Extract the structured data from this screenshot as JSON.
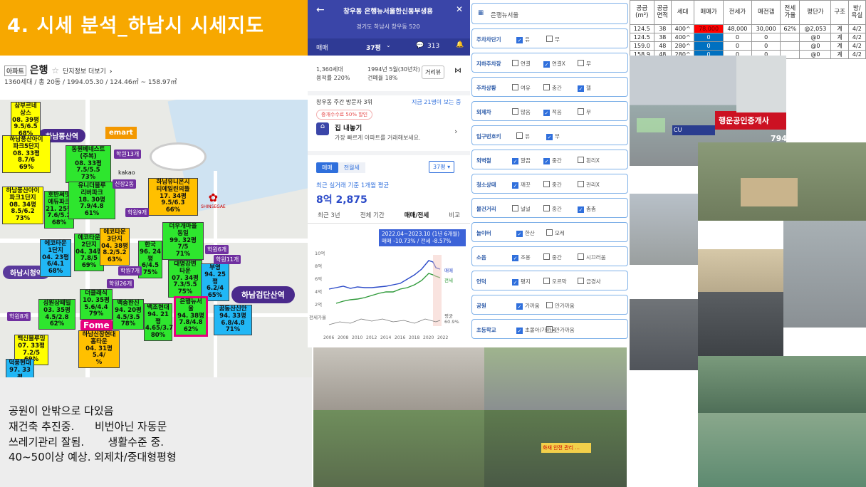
{
  "slide_title": "4. 시세 분석_하남시 시세지도",
  "map_header": {
    "tag": "아파트",
    "name": "은행",
    "link": "단지정보 더보기",
    "detail": "1360세대 / 총 20동 / 1994.05.30 / 124.46㎡ ~ 158.97㎡"
  },
  "stations": [
    {
      "name": "하남풍산역"
    },
    {
      "name": "하남검단산역"
    },
    {
      "name": "하남시청역"
    }
  ],
  "map_markers": {
    "emart": "emart",
    "kakao": "kakao",
    "shinsegae": "SHINSEGAE",
    "fome": "Fome"
  },
  "apt_labels": [
    {
      "l1": "삼부르네상스",
      "l2": "08. 39평",
      "l3": "9.5/6.5",
      "l4": "68%",
      "cls": "y"
    },
    {
      "l1": "하남풍산아이",
      "l2": "파크5단지",
      "l3": "08. 33평",
      "l4": "8.7/6",
      "l5": "69%",
      "cls": "y"
    },
    {
      "l1": "동원베네스트",
      "l2": "(주복)",
      "l3": "08. 33평",
      "l4": "7.5/5.5",
      "l5": "73%",
      "cls": "g"
    },
    {
      "l1": "하남풍산아이",
      "l2": "파크1단지",
      "l3": "08. 34평",
      "l4": "8.5/6.2",
      "l5": "73%",
      "cls": "y"
    },
    {
      "l1": "호반써밋",
      "l2": "에듀파크",
      "l3": "21. 25평",
      "l4": "7.6/5.2",
      "l5": "68%",
      "cls": "g"
    },
    {
      "l1": "유니더블루",
      "l2": "리버파크",
      "l3": "18. 30평",
      "l4": "7.9/4.8",
      "l5": "61%",
      "cls": "g"
    },
    {
      "l1": "하남유니온시",
      "l2": "티에일린의뜰",
      "l3": "17. 34평",
      "l4": "9.5/6.3",
      "l5": "66%",
      "cls": "o"
    },
    {
      "l1": "에코타운",
      "l2": "1단지",
      "l3": "04. 23평",
      "l4": "6/4.1",
      "l5": "68%",
      "cls": "c"
    },
    {
      "l1": "에코타운",
      "l2": "2단지",
      "l3": "04. 34평",
      "l4": "7.8/5",
      "l5": "69%",
      "cls": "g"
    },
    {
      "l1": "에코타운",
      "l2": "3단지",
      "l3": "04. 38평",
      "l4": "8.2/5.2",
      "l5": "63%",
      "cls": "o"
    },
    {
      "l1": "한국",
      "l2": "96. 24평",
      "l3": "6/4.5",
      "l4": "75%",
      "cls": "g"
    },
    {
      "l1": "더우개마을",
      "l2": "동일",
      "l3": "99. 32평",
      "l4": "7/5",
      "l5": "71%",
      "cls": "g"
    },
    {
      "l1": "대명강변",
      "l2": "타운",
      "l3": "07. 34평",
      "l4": "7.3/5.5",
      "l5": "75%",
      "cls": "g"
    },
    {
      "l1": "부영",
      "l2": "94. 25평",
      "l3": "6.2/4",
      "l4": "65%",
      "cls": "c"
    },
    {
      "l1": "성원상떼빌",
      "l2": "03. 35평",
      "l3": "4.5/2.8",
      "l4": "62%",
      "cls": "g"
    },
    {
      "l1": "더클래식",
      "l2": "10. 35평",
      "l3": "5.6/4.4",
      "l4": "79%",
      "cls": "g"
    },
    {
      "l1": "백송한신",
      "l2": "94. 20평",
      "l3": "4.5/3.5",
      "l4": "78%",
      "cls": "g"
    },
    {
      "l1": "백조현대",
      "l2": "94. 21평",
      "l3": "4.65/3.7",
      "l4": "80%",
      "cls": "g"
    },
    {
      "l1": "은행뉴서",
      "l2": "울",
      "l3": "94. 38평",
      "l4": "7.8/4.8",
      "l5": "62%",
      "cls": "g"
    },
    {
      "l1": "꿈동산신안",
      "l2": "94. 33평",
      "l3": "6.8/4.8",
      "l4": "71%",
      "cls": "c"
    },
    {
      "l1": "하남신장현대",
      "l2": "홈타운",
      "l3": "04. 31평",
      "l4": "5.4/",
      "l5": "%",
      "cls": "o"
    },
    {
      "l1": "백신블루밍",
      "l2": "07. 33평",
      "l3": "7.2/5",
      "l4": "69%",
      "cls": "y"
    },
    {
      "l1": "덕풍현대",
      "l2": "97. 33평",
      "cls": "c"
    }
  ],
  "pins": [
    "학원13개",
    "학원9개",
    "학원26개",
    "학원8개",
    "학원6개",
    "학원11개",
    "학원7개",
    "신장2동"
  ],
  "notes": [
    "공원이 안밖으로 다있음",
    "재건축 추진중.      비번아닌 자동문",
    "쓰레기관리 잘됨.       생활수준 중.",
    "40~50이상 예상. 외제차/중대형평형"
  ],
  "app": {
    "title": "창우동 은행뉴서울한신동부생용",
    "subtitle": "경기도 하남시 창우동 520",
    "trade_tab": "매매",
    "size": "37평",
    "comments": "313",
    "units": "1,360세대",
    "built": "1994년 5월(30년차)",
    "far": "용적률 220%",
    "bcr": "건폐율 18%",
    "dist_btn": "거리뷰",
    "rank": "창우동 주간 방문자 3위",
    "views": "지금 21명이 보는 중",
    "promo": "중개수수료 50% 할인",
    "sell_title": "집 내놓기",
    "sell_sub": "가장 빠르게 아파트를 거래해보세요.",
    "tabs": [
      "매매",
      "전월세"
    ],
    "size_select": "37평",
    "avg_label": "최근 실거래 기준 1개월 평균",
    "avg_price": "8억 2,875",
    "periods": [
      "최근 3년",
      "전체 기간",
      "매매/전세",
      "비교"
    ],
    "tooltip": "2022.04~2023.10 (1년 6개월)",
    "tooltip2": "매매 -10.73% / 전세 -8.57%",
    "y_ticks": [
      "10억",
      "8억",
      "6억",
      "4억",
      "2억"
    ],
    "x_ticks": [
      "2006",
      "2008",
      "2010",
      "2012",
      "2014",
      "2016",
      "2018",
      "2020",
      "2022"
    ],
    "legend": [
      "매매",
      "전세"
    ],
    "ratio_label": "전세가율",
    "ratio_right": "평균",
    "ratio_val": "60.9%"
  },
  "checklist": {
    "header": "은행뉴서울",
    "rows": [
      {
        "label": "주차차단기",
        "opts": [
          [
            "유",
            true
          ],
          [
            "무",
            false
          ]
        ]
      },
      {
        "label": "지하주차장",
        "opts": [
          [
            "연결",
            false
          ],
          [
            "연결X",
            true
          ],
          [
            "무",
            false
          ]
        ]
      },
      {
        "label": "주차상황",
        "opts": [
          [
            "여유",
            false
          ],
          [
            "충간",
            false
          ],
          [
            "헬",
            true
          ]
        ]
      },
      {
        "label": "외제차",
        "opts": [
          [
            "많음",
            false
          ],
          [
            "적음",
            true
          ],
          [
            "무",
            false
          ]
        ]
      },
      {
        "label": "입구번호키",
        "opts": [
          [
            "유",
            false
          ],
          [
            "무",
            true
          ]
        ]
      },
      {
        "label": "외벽철",
        "opts": [
          [
            "깔끔",
            true
          ],
          [
            "중간",
            true
          ],
          [
            "흰리X",
            false
          ]
        ]
      },
      {
        "label": "청소상태",
        "opts": [
          [
            "깨끗",
            true
          ],
          [
            "중간",
            false
          ],
          [
            "관리X",
            false
          ]
        ]
      },
      {
        "label": "물건거리",
        "opts": [
          [
            "널널",
            false
          ],
          [
            "중간",
            false
          ],
          [
            "촘촘",
            true
          ]
        ]
      },
      {
        "label": "놀이터",
        "opts": [
          [
            "한산",
            true
          ],
          [
            "모레",
            false
          ]
        ]
      },
      {
        "label": "소음",
        "opts": [
          [
            "조용",
            true
          ],
          [
            "중간",
            false
          ],
          [
            "시끄러움",
            false
          ]
        ]
      },
      {
        "label": "언덕",
        "opts": [
          [
            "평지",
            true
          ],
          [
            "오르막",
            false
          ],
          [
            "급경사",
            false
          ]
        ]
      },
      {
        "label": "공원",
        "opts": [
          [
            "가까움",
            true
          ],
          [
            "안가까움",
            false
          ]
        ]
      },
      {
        "label": "초등학교",
        "opts": [
          [
            "초몰아/가까움",
            true
          ],
          [
            "안가까움",
            false
          ]
        ]
      }
    ]
  },
  "table": {
    "headers": [
      "공급\n(m²)",
      "공급\n면적",
      "세대",
      "매매가",
      "전세가",
      "매전갭",
      "전세\n가율",
      "평단가",
      "구조",
      "방/\n욕실"
    ],
    "rows": [
      [
        "124.5",
        "38",
        "400^",
        "78,000",
        "48,000",
        "30,000",
        "62%",
        "@2,053",
        "계",
        "4/2"
      ],
      [
        "124.5",
        "38",
        "400^",
        "0",
        "0",
        "0",
        "",
        "@0",
        "계",
        "4/2"
      ],
      [
        "159.0",
        "48",
        "280^",
        "0",
        "0",
        "0",
        "",
        "@0",
        "계",
        "4/2"
      ],
      [
        "158.9",
        "48",
        "280^",
        "0",
        "0",
        "0",
        "",
        "@0",
        "계",
        "4/2"
      ]
    ]
  },
  "photos": {
    "shop_sign": "행운공인중개사",
    "cu": "CU",
    "num": "794",
    "banner": "화재 안전 관리 ..."
  },
  "colors": {
    "title_bg": "#f7a800",
    "app_header": "#3a45a8",
    "accent": "#2f6fdc"
  }
}
